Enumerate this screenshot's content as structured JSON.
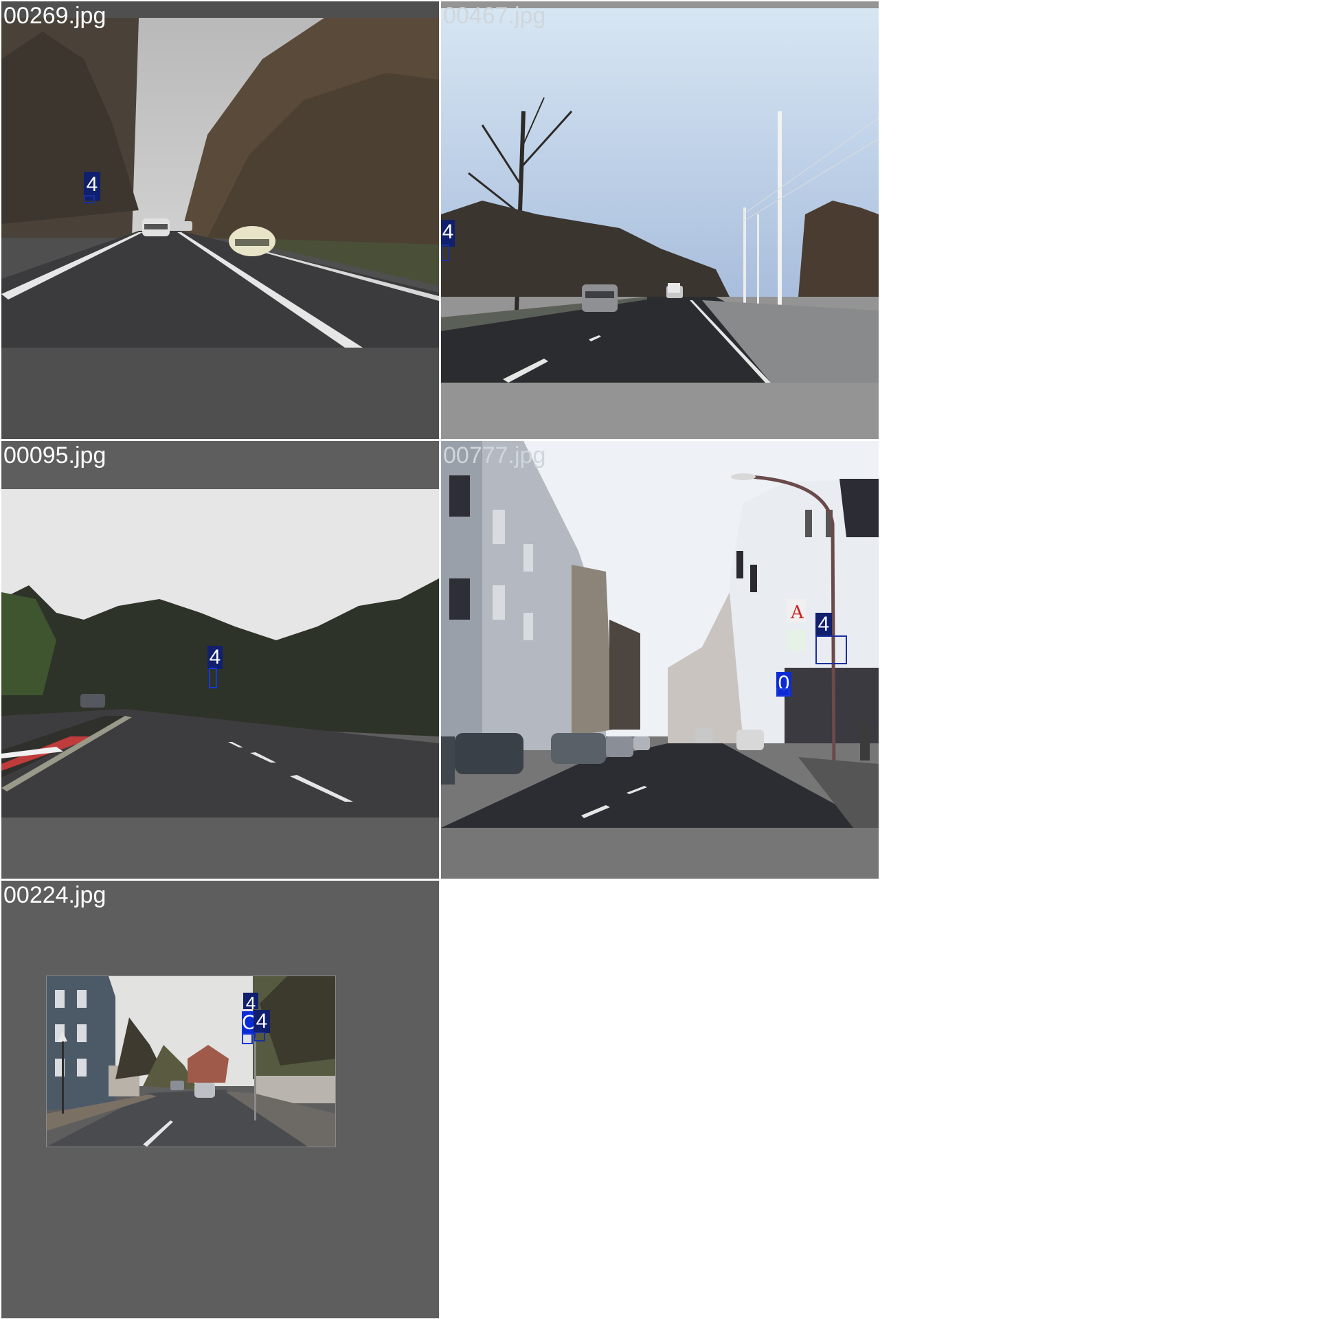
{
  "mosaic": {
    "tiles": [
      {
        "filename": "00269.jpg",
        "labels": [
          "4"
        ]
      },
      {
        "filename": "00467.jpg",
        "labels": [
          "4"
        ]
      },
      {
        "filename": "00095.jpg",
        "labels": [
          "4"
        ]
      },
      {
        "filename": "00777.jpg",
        "labels": [
          "4",
          "0"
        ]
      },
      {
        "filename": "00224.jpg",
        "labels": [
          "4",
          "C",
          "4"
        ]
      }
    ]
  },
  "colors": {
    "page_background": "#ffffff",
    "letterbox_dark": "#5e5e5e",
    "letterbox_light": "#949494",
    "label_dark_blue": "#101f6e",
    "label_bright_blue": "#0b2bd6"
  }
}
